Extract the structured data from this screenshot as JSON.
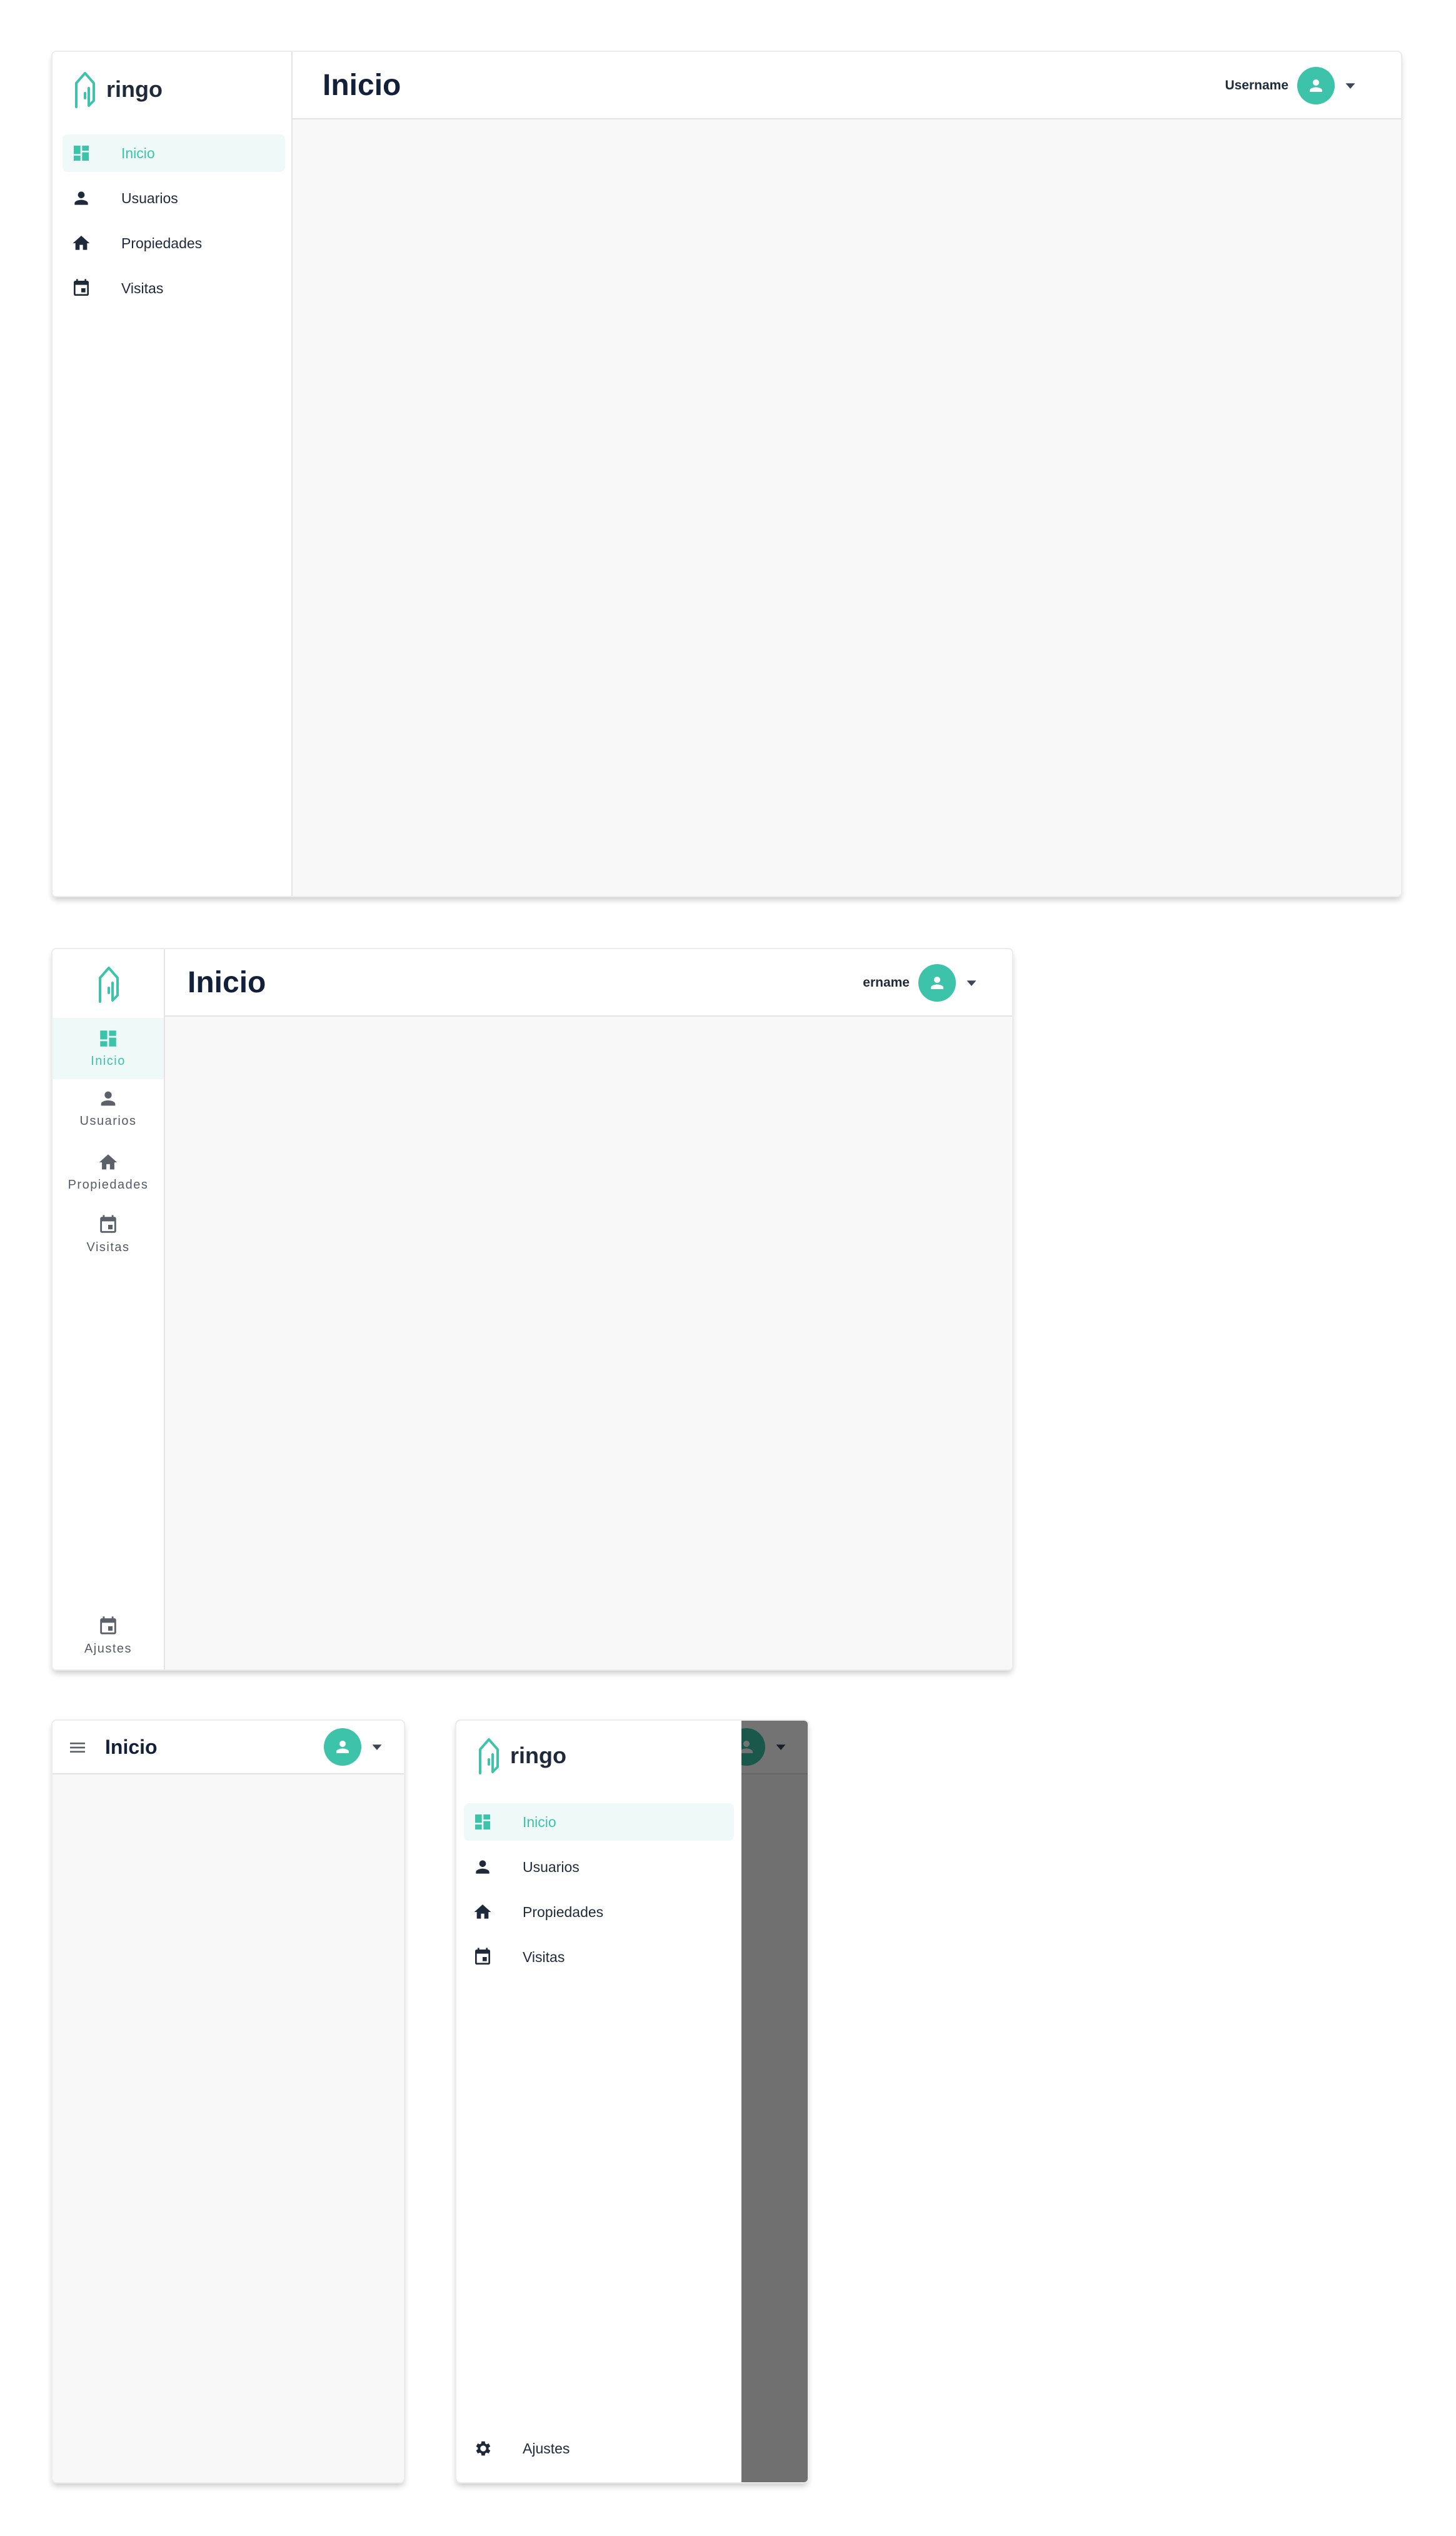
{
  "app": {
    "brand": "ringo",
    "accent_color": "#3cc3a9",
    "text_color": "#1e2a3a"
  },
  "page": {
    "title": "Inicio"
  },
  "user": {
    "name": "Username",
    "name_clipped": "ername",
    "avatar_icon": "person-icon",
    "menu_icon": "caret-down-icon"
  },
  "nav": {
    "items": [
      {
        "label": "Inicio",
        "icon": "dashboard-icon",
        "active": true
      },
      {
        "label": "Usuarios",
        "icon": "person-icon",
        "active": false
      },
      {
        "label": "Propiedades",
        "icon": "home-icon",
        "active": false
      },
      {
        "label": "Visitas",
        "icon": "calendar-icon",
        "active": false
      }
    ],
    "settings": {
      "label": "Ajustes",
      "icon_rail": "calendar-icon",
      "icon_drawer": "gear-icon"
    }
  },
  "mobile": {
    "menu_icon": "hamburger-icon"
  }
}
